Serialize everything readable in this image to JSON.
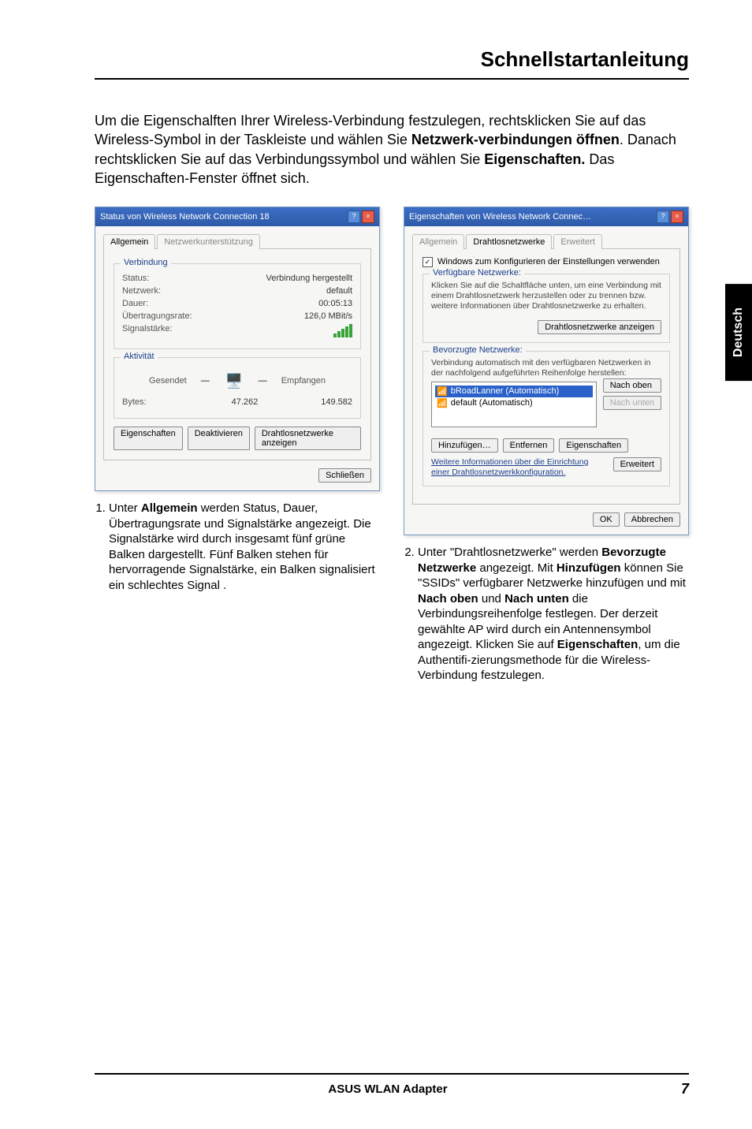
{
  "side_tab": "Deutsch",
  "header": {
    "title": "Schnellstartanleitung"
  },
  "intro_html": "Um die Eigenschalften Ihrer Wireless-Verbindung festzulegen, rechtsklicken Sie auf das Wireless-Symbol in der Taskleiste und wählen Sie <b>Netzwerk-verbindungen öffnen</b>. Danach rechtsklicken Sie auf das Verbindungssymbol und wählen Sie <b>Eigenschaften.</b> Das Eigenschaften-Fenster öffnet sich.",
  "left": {
    "win_title": "Status von Wireless Network Connection 18",
    "tabs": {
      "general": "Allgemein",
      "support": "Netzwerkunterstützung"
    },
    "group1_title": "Verbindung",
    "rows": {
      "status_l": "Status:",
      "status_v": "Verbindung hergestellt",
      "net_l": "Netzwerk:",
      "net_v": "default",
      "dur_l": "Dauer:",
      "dur_v": "00:05:13",
      "rate_l": "Übertragungsrate:",
      "rate_v": "126,0 MBit/s",
      "sig_l": "Signalstärke:"
    },
    "group2_title": "Aktivität",
    "activity": {
      "sent_l": "Gesendet",
      "recv_l": "Empfangen",
      "bytes_l": "Bytes:",
      "sent": "47.262",
      "recv": "149.582"
    },
    "buttons": {
      "props": "Eigenschaften",
      "disable": "Deaktivieren",
      "view": "Drahtlosnetzwerke anzeigen",
      "close": "Schließen"
    },
    "caption_html": "Unter <b>Allgemein</b> werden Status, Dauer, Übertragungsrate und Signalstärke angezeigt. Die Signalstärke wird durch insgesamt fünf grüne Balken dargestellt. Fünf Balken stehen für hervorragende Signalstärke, ein Balken signalisiert ein schlechtes Signal ."
  },
  "right": {
    "win_title": "Eigenschaften von Wireless Network Connec…",
    "tabs": {
      "general": "Allgemein",
      "wireless": "Drahtlosnetzwerke",
      "advanced": "Erweitert"
    },
    "checkbox": "Windows zum Konfigurieren der Einstellungen verwenden",
    "group1_title": "Verfügbare Netzwerke:",
    "group1_text": "Klicken Sie auf die Schaltfläche unten, um eine Verbindung mit einem Drahtlosnetzwerk herzustellen oder zu trennen bzw. weitere Informationen über Drahtlosnetzwerke zu erhalten.",
    "group1_btn": "Drahtlosnetzwerke anzeigen",
    "group2_title": "Bevorzugte Netzwerke:",
    "group2_text": "Verbindung automatisch mit den verfügbaren Netzwerken in der nachfolgend aufgeführten Reihenfolge herstellen:",
    "list": {
      "item1": "bRoadLanner (Automatisch)",
      "item2": "default (Automatisch)"
    },
    "side_buttons": {
      "up": "Nach oben",
      "down": "Nach unten"
    },
    "bottom_buttons": {
      "add": "Hinzufügen…",
      "remove": "Entfernen",
      "props": "Eigenschaften"
    },
    "link_text": "Weitere Informationen über die Einrichtung einer Drahtlosnetzwerkkonfiguration.",
    "adv_btn": "Erweitert",
    "ok_btn": "OK",
    "cancel_btn": "Abbrechen",
    "caption_html": "Unter \"Drahtlosnetzwerke\" werden <b>Bevorzugte Netzwerke</b> angezeigt. Mit <b>Hinzufügen</b> können Sie \"SSIDs\" verfügbarer Netzwerke hinzufügen und mit <b>Nach oben</b> und <b>Nach unten</b> die Verbindungsreihenfolge festlegen. Der derzeit gewählte AP wird durch ein Antennensymbol angezeigt.  Klicken Sie auf <b>Eigenschaften</b>, um die Authentifi-zierungsmethode für die Wireless-Verbindung festzulegen."
  },
  "footer": {
    "product": "ASUS WLAN Adapter",
    "page": "7"
  }
}
